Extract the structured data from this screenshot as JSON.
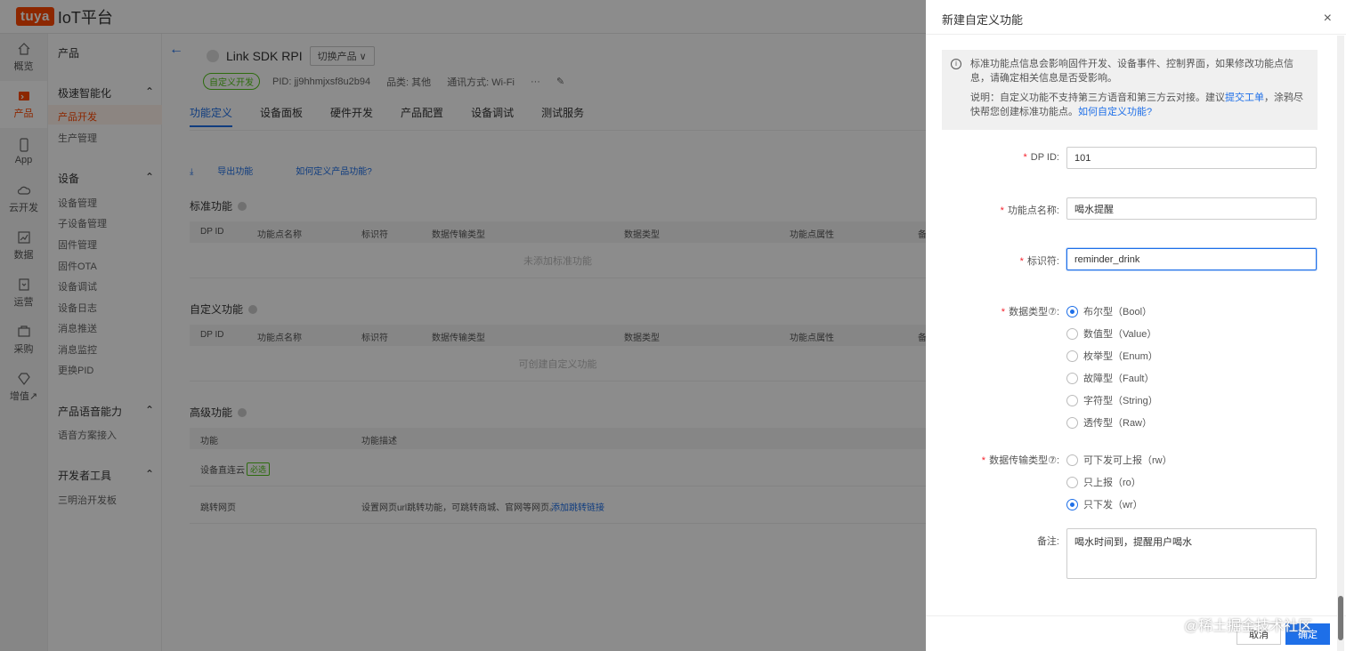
{
  "brand": {
    "logo_text": "tuya",
    "platform": "IoT平台"
  },
  "iconbar": [
    {
      "label": "概览",
      "icon": "home-icon"
    },
    {
      "label": "产品",
      "icon": "product-icon",
      "active": true
    },
    {
      "label": "App",
      "icon": "phone-icon"
    },
    {
      "label": "云开发",
      "icon": "cloud-icon"
    },
    {
      "label": "数据",
      "icon": "chart-icon"
    },
    {
      "label": "运营",
      "icon": "operate-icon"
    },
    {
      "label": "采购",
      "icon": "cart-icon"
    },
    {
      "label": "增值↗",
      "icon": "diamond-icon"
    }
  ],
  "sidebar": {
    "title": "产品",
    "groups": [
      {
        "label": "极速智能化",
        "items": [
          "产品开发",
          "生产管理"
        ]
      },
      {
        "label": "设备",
        "items": [
          "设备管理",
          "子设备管理",
          "固件管理",
          "固件OTA",
          "设备调试",
          "设备日志",
          "消息推送",
          "消息监控",
          "更换PID"
        ]
      },
      {
        "label": "产品语音能力",
        "items": [
          "语音方案接入"
        ]
      },
      {
        "label": "开发者工具",
        "items": [
          "三明治开发板"
        ]
      }
    ]
  },
  "product": {
    "name": "Link SDK RPI",
    "switch_label": "切换产品",
    "tag": "自定义开发",
    "pid": "PID: jj9hhmjxsf8u2b94",
    "category": "品类: 其他",
    "comm": "通讯方式: Wi-Fi",
    "more": "···"
  },
  "tabs": [
    "功能定义",
    "设备面板",
    "硬件开发",
    "产品配置",
    "设备调试",
    "测试服务"
  ],
  "actions": {
    "export": "导出功能",
    "howto": "如何定义产品功能?"
  },
  "table_headers": [
    "DP ID",
    "功能点名称",
    "标识符",
    "数据传输类型",
    "数据类型",
    "功能点属性",
    "备"
  ],
  "standard": {
    "title": "标准功能",
    "empty": "未添加标准功能"
  },
  "custom": {
    "title": "自定义功能",
    "empty": "可创建自定义功能"
  },
  "advanced": {
    "title": "高级功能",
    "headers": [
      "功能",
      "功能描述"
    ],
    "rows": [
      {
        "name": "设备直连云",
        "tag": "必选",
        "desc": ""
      },
      {
        "name": "跳转网页",
        "desc": "设置网页url跳转功能，可跳转商城、官网等网页。",
        "link": "添加跳转链接"
      }
    ]
  },
  "drawer": {
    "title": "新建自定义功能",
    "close": "×",
    "notice_1": "标准功能点信息会影响固件开发、设备事件、控制界面，如果修改功能点信息，请确定相关信息是否受影响。",
    "notice_2_pre": "说明：自定义功能不支持第三方语音和第三方云对接。建议",
    "notice_2_link1": "提交工单",
    "notice_2_mid": "，涂鸦尽快帮您创建标准功能点。",
    "notice_2_link2": "如何自定义功能?",
    "fields": {
      "dpid": {
        "label": "DP ID:",
        "value": "101"
      },
      "name": {
        "label": "功能点名称:",
        "value": "喝水提醒"
      },
      "identifier": {
        "label": "标识符:",
        "value": "reminder_drink"
      },
      "data_type": {
        "label": "数据类型⑦:"
      },
      "transfer_type": {
        "label": "数据传输类型⑦:"
      },
      "remark": {
        "label": "备注:",
        "value": "喝水时间到，提醒用户喝水"
      }
    },
    "data_types": [
      "布尔型（Bool）",
      "数值型（Value）",
      "枚举型（Enum）",
      "故障型（Fault）",
      "字符型（String）",
      "透传型（Raw）"
    ],
    "data_type_selected": 0,
    "transfer_types": [
      "可下发可上报（rw）",
      "只上报（ro）",
      "只下发（wr）"
    ],
    "transfer_type_selected": 2,
    "cancel": "取消",
    "ok": "确定"
  },
  "watermark": "@稀土掘金技术社区"
}
